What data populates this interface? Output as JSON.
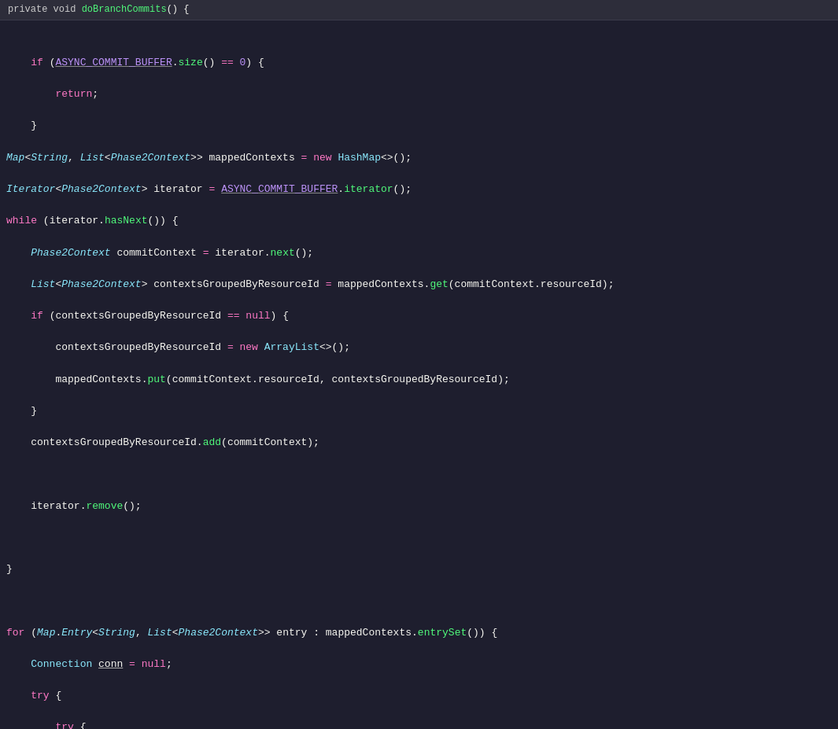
{
  "header": {
    "text": "private void doBranchCommits() {"
  },
  "colors": {
    "background": "#1e1e2e",
    "header_bg": "#2d2d3a",
    "text": "#f8f8f2"
  }
}
